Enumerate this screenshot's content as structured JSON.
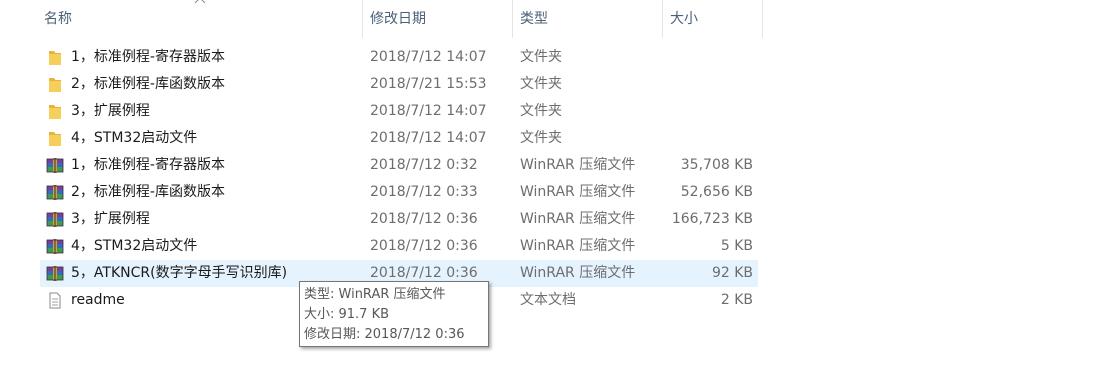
{
  "columns": {
    "name": "名称",
    "date": "修改日期",
    "type": "类型",
    "size": "大小"
  },
  "files": [
    {
      "icon": "folder-icon",
      "name": "1，标准例程-寄存器版本",
      "date": "2018/7/12 14:07",
      "type": "文件夹",
      "size": ""
    },
    {
      "icon": "folder-icon",
      "name": "2，标准例程-库函数版本",
      "date": "2018/7/21 15:53",
      "type": "文件夹",
      "size": ""
    },
    {
      "icon": "folder-icon",
      "name": "3，扩展例程",
      "date": "2018/7/12 14:07",
      "type": "文件夹",
      "size": ""
    },
    {
      "icon": "folder-icon",
      "name": "4，STM32启动文件",
      "date": "2018/7/12 14:07",
      "type": "文件夹",
      "size": ""
    },
    {
      "icon": "winrar-archive-icon",
      "name": "1，标准例程-寄存器版本",
      "date": "2018/7/12 0:32",
      "type": "WinRAR 压缩文件",
      "size": "35,708 KB"
    },
    {
      "icon": "winrar-archive-icon",
      "name": "2，标准例程-库函数版本",
      "date": "2018/7/12 0:33",
      "type": "WinRAR 压缩文件",
      "size": "52,656 KB"
    },
    {
      "icon": "winrar-archive-icon",
      "name": "3，扩展例程",
      "date": "2018/7/12 0:36",
      "type": "WinRAR 压缩文件",
      "size": "166,723 KB"
    },
    {
      "icon": "winrar-archive-icon",
      "name": "4，STM32启动文件",
      "date": "2018/7/12 0:36",
      "type": "WinRAR 压缩文件",
      "size": "5 KB"
    },
    {
      "icon": "winrar-archive-icon",
      "name": "5，ATKNCR(数字字母手写识别库)",
      "date": "2018/7/12 0:36",
      "type": "WinRAR 压缩文件",
      "size": "92 KB",
      "hovered": true
    },
    {
      "icon": "text-document-icon",
      "name": "readme",
      "date": "",
      "type": "文本文档",
      "size": "2 KB"
    }
  ],
  "tooltip": {
    "type_line": "类型: WinRAR 压缩文件",
    "size_line": "大小: 91.7 KB",
    "date_line": "修改日期: 2018/7/12 0:36"
  },
  "colors": {
    "folder": "#f2c649",
    "hover_row": "#e5f3ff",
    "header_text": "#4c607a"
  }
}
